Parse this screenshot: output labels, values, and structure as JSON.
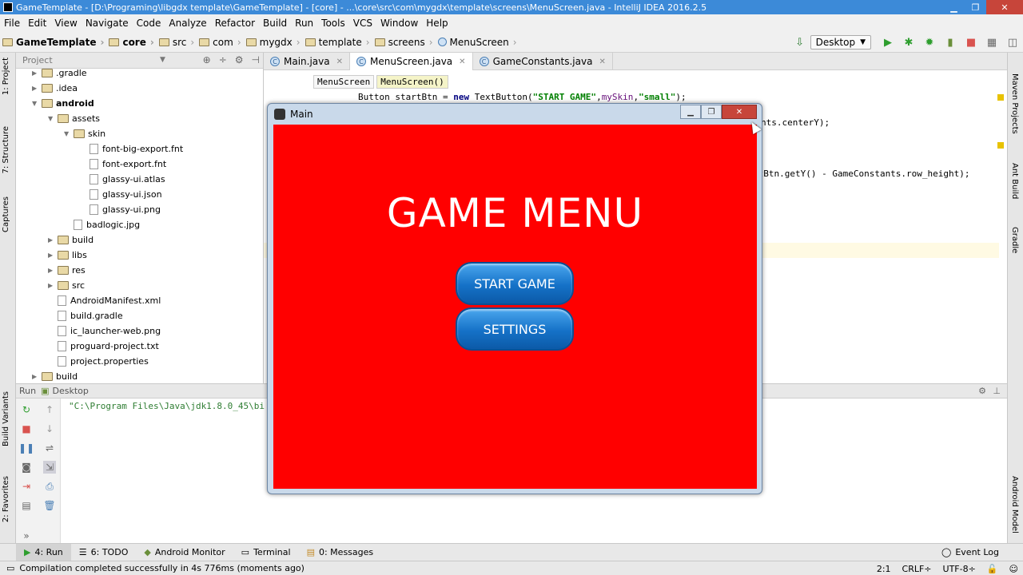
{
  "window": {
    "title": "GameTemplate - [D:\\Programing\\libgdx template\\GameTemplate] - [core] - ...\\core\\src\\com\\mygdx\\template\\screens\\MenuScreen.java - IntelliJ IDEA 2016.2.5",
    "minimize": "▁",
    "maximize": "❐",
    "close": "✕"
  },
  "menubar": [
    "File",
    "Edit",
    "View",
    "Navigate",
    "Code",
    "Analyze",
    "Refactor",
    "Build",
    "Run",
    "Tools",
    "VCS",
    "Window",
    "Help"
  ],
  "breadcrumbs": [
    "GameTemplate",
    "core",
    "src",
    "com",
    "mygdx",
    "template",
    "screens",
    "MenuScreen"
  ],
  "run_config": "Desktop",
  "left_tool_tabs": {
    "project": "1: Project",
    "structure": "7: Structure",
    "captures": "Captures",
    "build_variants": "Build Variants",
    "favorites": "2: Favorites"
  },
  "right_tool_tabs": {
    "maven": "Maven Projects",
    "ant": "Ant Build",
    "gradle": "Gradle",
    "android_model": "Android Model"
  },
  "project_panel": {
    "header": "Project",
    "items": [
      {
        "label": ".gradle",
        "type": "folder",
        "arrow": "▶"
      },
      {
        "label": ".idea",
        "type": "folder",
        "arrow": "▶"
      },
      {
        "label": "android",
        "type": "folder",
        "arrow": "▼",
        "bold": true
      },
      {
        "label": "assets",
        "type": "folder",
        "arrow": "▼"
      },
      {
        "label": "skin",
        "type": "folder",
        "arrow": "▼"
      },
      {
        "label": "font-big-export.fnt",
        "type": "file"
      },
      {
        "label": "font-export.fnt",
        "type": "file"
      },
      {
        "label": "glassy-ui.atlas",
        "type": "file"
      },
      {
        "label": "glassy-ui.json",
        "type": "file"
      },
      {
        "label": "glassy-ui.png",
        "type": "file"
      },
      {
        "label": "badlogic.jpg",
        "type": "file"
      },
      {
        "label": "build",
        "type": "folder",
        "arrow": "▶"
      },
      {
        "label": "libs",
        "type": "folder",
        "arrow": "▶"
      },
      {
        "label": "res",
        "type": "folder",
        "arrow": "▶"
      },
      {
        "label": "src",
        "type": "folder",
        "arrow": "▶"
      },
      {
        "label": "AndroidManifest.xml",
        "type": "file"
      },
      {
        "label": "build.gradle",
        "type": "file"
      },
      {
        "label": "ic_launcher-web.png",
        "type": "file"
      },
      {
        "label": "proguard-project.txt",
        "type": "file"
      },
      {
        "label": "project.properties",
        "type": "file"
      },
      {
        "label": "build",
        "type": "folder",
        "arrow": "▶"
      }
    ]
  },
  "editor_tabs": [
    {
      "label": "Main.java",
      "active": false
    },
    {
      "label": "MenuScreen.java",
      "active": true
    },
    {
      "label": "GameConstants.java",
      "active": false
    }
  ],
  "editor": {
    "crumb_class": "MenuScreen",
    "crumb_method": "MenuScreen()",
    "line1_pre": "Button startBtn = ",
    "line1_kw": "new",
    "line1_mid": " TextButton(",
    "line1_str1": "\"START GAME\"",
    "line1_comma": ",",
    "line1_fld": "mySkin",
    "line1_str2": "\"small\"",
    "line1_end": ");",
    "line2": "nts.centerY);",
    "line3": "rtBtn.getY() - GameConstants.row_height);"
  },
  "run_panel": {
    "header_run": "Run",
    "header_config": "Desktop",
    "output": "\"C:\\Program Files\\Java\\jdk1.8.0_45\\bi"
  },
  "game_window": {
    "title": "Main",
    "heading": "GAME MENU",
    "buttons": [
      "START GAME",
      "SETTINGS"
    ]
  },
  "bottom_tabs": [
    "4: Run",
    "6: TODO",
    "Android Monitor",
    "Terminal",
    "0: Messages"
  ],
  "event_log": "Event Log",
  "status": {
    "message": "Compilation completed successfully in 4s 776ms (moments ago)",
    "position": "2:1",
    "line_sep": "CRLF÷",
    "encoding": "UTF-8÷"
  },
  "colors": {
    "game_background": "#ff0000",
    "button_blue": "#1571c7",
    "titlebar_blue": "#3c8ad8"
  }
}
